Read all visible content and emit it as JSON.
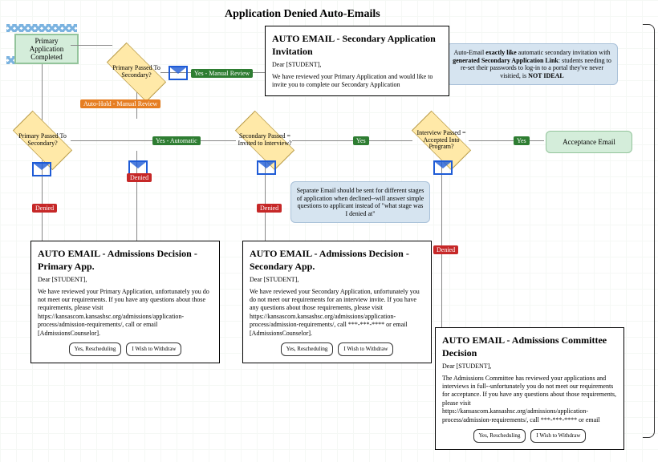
{
  "title": "Application Denied Auto-Emails",
  "start": "Primary Application Completed",
  "diamonds": {
    "d1": "Primary Passed To Secondary?",
    "d2": "Primary Passed To Secondary?",
    "d3": "Secondary Passed = Invited to Interview?",
    "d4": "Interview Passed = Accepted Into Program?"
  },
  "tags": {
    "yesManual": "Yes - Manual Review",
    "yesAuto": "Yes - Automatic",
    "autoHold": "Auto-Hold - Manual Review",
    "yes": "Yes",
    "denied": "Denied"
  },
  "accept": "Acceptance Email",
  "note1": {
    "t1": "Auto-Email ",
    "b1": "exactly like",
    "t2": " automatic secondary invitation with ",
    "b2": "generated Secondary Application Link",
    "t3": ": students needing to re-set their passwords to log-in to a portal they've never visitied, is ",
    "b3": "NOT IDEAL"
  },
  "note2": "Separate Email should be sent for different stages of application when declined--will answer simple questions to applicant instead of \"what stage was I denied at\"",
  "emails": {
    "secInvite": {
      "h": "AUTO EMAIL - Secondary Application Invitation",
      "g": "Dear [STUDENT],",
      "b": "We have reviewed your Primary Application and would like to invite you to complete our Secondary Application"
    },
    "primary": {
      "h": "AUTO EMAIL - Admissions Decision - Primary App.",
      "g": "Dear [STUDENT],",
      "b": "We have reviewed your Primary Application, unfortunately you do not meet our requirements. If you have any questions about those requirements, please visit https://kansascom.kansashsc.org/admissions/application-process/admission-requirements/, call or email [AdmissionsCounselor].",
      "btn1": "Yes, Rescheduling",
      "btn2": "I Wish to Withdraw"
    },
    "secondary": {
      "h": "AUTO EMAIL - Admissions Decision - Secondary App.",
      "g": "Dear [STUDENT],",
      "b": "We have reviewed your Secondary Application, unfortunately you do not meet our requirements for an interview invite. If you have any questions about those requirements, please visit https://kansascom.kansashsc.org/admissions/application-process/admission-requirements/, call ***-***-**** or email [AdmissionsCounselor].",
      "btn1": "Yes, Rescheduling",
      "btn2": "I Wish to Withdraw"
    },
    "committee": {
      "h": "AUTO EMAIL - Admissions Committee Decision",
      "g": "Dear [STUDENT],",
      "b": "The Admissions Committee has reviewed your applications and interviews in full--unfortunately you do not meet our requirements for acceptance. If you have any questions about those requirements, please visit https://kansascom.kansashsc.org/admissions/application-process/admission-requirements/, call ***-***-**** or email",
      "btn1": "Yes, Rescheduling",
      "btn2": "I Wish to Withdraw"
    }
  }
}
